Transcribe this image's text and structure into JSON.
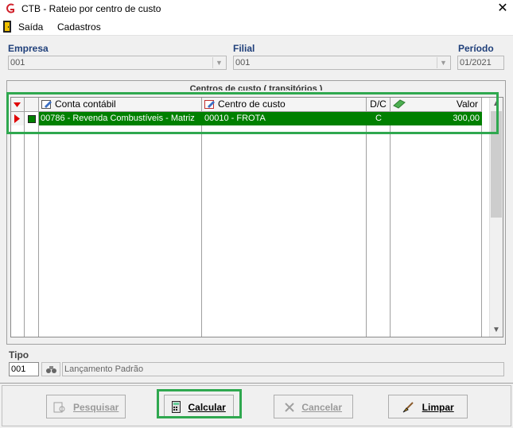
{
  "window": {
    "title": "CTB - Rateio por centro de custo",
    "close_symbol": "✕"
  },
  "menu": {
    "items": [
      {
        "label": "Saída"
      },
      {
        "label": "Cadastros"
      }
    ]
  },
  "fields": {
    "empresa": {
      "label": "Empresa",
      "value": "001"
    },
    "filial": {
      "label": "Filial",
      "value": "001"
    },
    "periodo": {
      "label": "Período",
      "value": "01/2021"
    }
  },
  "grid": {
    "group_title": "Centros de custo ( transitórios )",
    "columns": [
      "Conta contábil",
      "Centro de custo",
      "D/C",
      "Valor"
    ],
    "rows": [
      {
        "conta": "00786 - Revenda Combustíveis - Matriz",
        "centro": "00010 - FROTA",
        "dc": "C",
        "valor": "300,00"
      }
    ]
  },
  "tipo": {
    "label": "Tipo",
    "code": "001",
    "description": "Lançamento Padrão"
  },
  "buttons": {
    "pesquisar": "Pesquisar",
    "calcular": "Calcular",
    "cancelar": "Cancelar",
    "limpar": "Limpar"
  },
  "colors": {
    "selected_row": "#008000",
    "highlight": "#2fa84f",
    "label_blue": "#1f3f7a",
    "indicator_red": "#e00000"
  },
  "icons": [
    "app-logo-icon",
    "exit-door-icon",
    "edit-pencil-icon",
    "edit-grid-icon",
    "money-icon",
    "binoculars-icon",
    "calculator-icon",
    "cancel-x-icon",
    "search-doc-icon",
    "broom-icon"
  ]
}
